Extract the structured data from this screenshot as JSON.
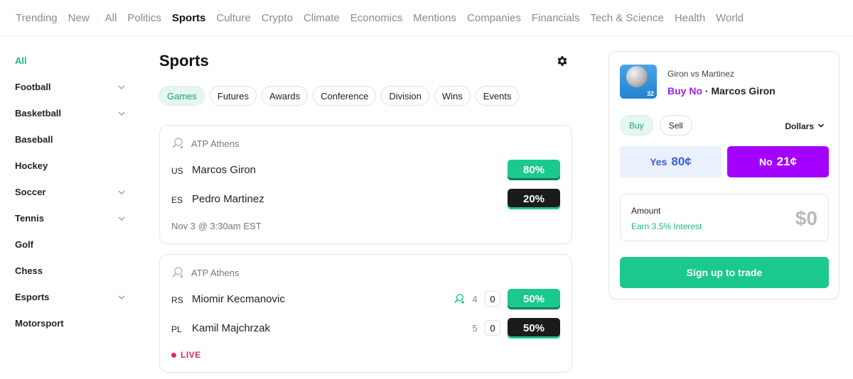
{
  "nav": {
    "items": [
      "Trending",
      "New",
      "All",
      "Politics",
      "Sports",
      "Culture",
      "Crypto",
      "Climate",
      "Economics",
      "Mentions",
      "Companies",
      "Financials",
      "Tech & Science",
      "Health",
      "World"
    ],
    "active": "Sports"
  },
  "sidebar": {
    "items": [
      {
        "label": "All",
        "active": true,
        "expandable": false
      },
      {
        "label": "Football",
        "expandable": true
      },
      {
        "label": "Basketball",
        "expandable": true
      },
      {
        "label": "Baseball",
        "expandable": false
      },
      {
        "label": "Hockey",
        "expandable": false
      },
      {
        "label": "Soccer",
        "expandable": true
      },
      {
        "label": "Tennis",
        "expandable": true
      },
      {
        "label": "Golf",
        "expandable": false
      },
      {
        "label": "Chess",
        "expandable": false
      },
      {
        "label": "Esports",
        "expandable": true
      },
      {
        "label": "Motorsport",
        "expandable": false
      }
    ]
  },
  "main": {
    "title": "Sports",
    "filters": [
      "Games",
      "Futures",
      "Awards",
      "Conference",
      "Division",
      "Wins",
      "Events"
    ],
    "active_filter": "Games",
    "cards": [
      {
        "league": "ATP Athens",
        "rows": [
          {
            "country": "US",
            "player": "Marcos Giron",
            "pct": "80%"
          },
          {
            "country": "ES",
            "player": "Pedro Martinez",
            "pct": "20%"
          }
        ],
        "footer": "Nov 3 @ 3:30am EST"
      },
      {
        "league": "ATP Athens",
        "rows": [
          {
            "country": "RS",
            "player": "Miomir Kecmanovic",
            "games": "4",
            "score": "0",
            "pct": "50%",
            "serving": true
          },
          {
            "country": "PL",
            "player": "Kamil Majchrzak",
            "games": "5",
            "score": "0",
            "pct": "50%"
          }
        ],
        "status": "LIVE"
      }
    ]
  },
  "trade": {
    "thumb_number": "32",
    "match_title": "Giron vs Martinez",
    "selection_side": "Buy No",
    "selection_sep": " · ",
    "selection_player": "Marcos Giron",
    "tabs": [
      "Buy",
      "Sell"
    ],
    "active_tab": "Buy",
    "currency": "Dollars",
    "yes": {
      "label": "Yes",
      "price": "80¢"
    },
    "no": {
      "label": "No",
      "price": "21¢"
    },
    "amount_label": "Amount",
    "earn_text": "Earn 3.5% Interest",
    "amount_value": "$0",
    "cta": "Sign up to trade"
  },
  "colors": {
    "accent_green": "#1bc98e",
    "no_purple": "#a400ff",
    "yes_blue": "#3a62d6",
    "live_red": "#e02b4f"
  }
}
